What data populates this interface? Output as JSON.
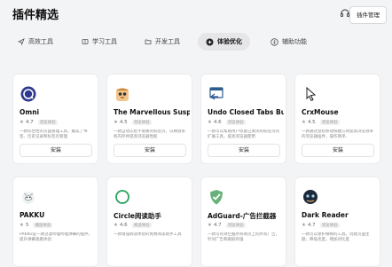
{
  "header": {
    "title": "插件精选",
    "manage_label": "插件管理"
  },
  "tabs": [
    {
      "label": "高效工具",
      "icon": "send-icon"
    },
    {
      "label": "学习工具",
      "icon": "book-icon"
    },
    {
      "label": "开发工具",
      "icon": "folder-icon"
    },
    {
      "label": "体验优化",
      "icon": "sparkle-icon",
      "active": true
    },
    {
      "label": "辅助功能",
      "icon": "accessibility-icon"
    }
  ],
  "cards": [
    {
      "name": "Omni",
      "rating": "4.7",
      "badge": "浏览体验",
      "desc": "一款综合性的页面管理工具，集成了书签、历史记录和标签页管理",
      "install": "安装",
      "icon": "omni-logo"
    },
    {
      "name": "The Marvellous Susp...",
      "rating": "4.5",
      "badge": "浏览体验",
      "desc": "一款自动冻结不需要的标签页，以释放系统内存并提高浏览器性能",
      "install": "安装",
      "icon": "suspender-logo"
    },
    {
      "name": "Undo Closed Tabs Bu...",
      "rating": "4.6",
      "badge": "浏览体验",
      "desc": "一款可以帮助用户恢复已关闭的标签页的扩展工具，提高浏览器使用",
      "install": "安装",
      "icon": "undo-tabs-logo"
    },
    {
      "name": "CrxMouse",
      "rating": "4.5",
      "badge": "浏览体验",
      "desc": "一款通过鼠标移动快捷方式提高浏览效率的浏览器插件，操作简单、",
      "install": "安装",
      "icon": "crxmouse-logo"
    },
    {
      "name": "PAKKU",
      "rating": "5",
      "badge": "播放体验",
      "desc": "PAKKU是一款过滤哔哩哔哩弹幕的插件，提升弹幕观看体验",
      "install": "安装",
      "icon": "pakku-logo"
    },
    {
      "name": "Circle阅读助手",
      "rating": "4.6",
      "badge": "阅读体验",
      "desc": "一款增强阅读体验的免费阅读助手工具",
      "install": "安装",
      "icon": "circle-logo"
    },
    {
      "name": "AdGuard-广告拦截器",
      "rating": "4.7",
      "badge": "浏览体验",
      "desc": "一款可有效拦截所有网页上的所有广告，针对广告和跟踪的强",
      "install": "安装",
      "icon": "adguard-logo"
    },
    {
      "name": "Dark Reader",
      "rating": "4.7",
      "badge": "浏览体验",
      "desc": "一款可以保护眼睛的工具，创建页面主题，降低亮度，增加对比度",
      "install": "安装",
      "icon": "darkreader-logo"
    }
  ]
}
